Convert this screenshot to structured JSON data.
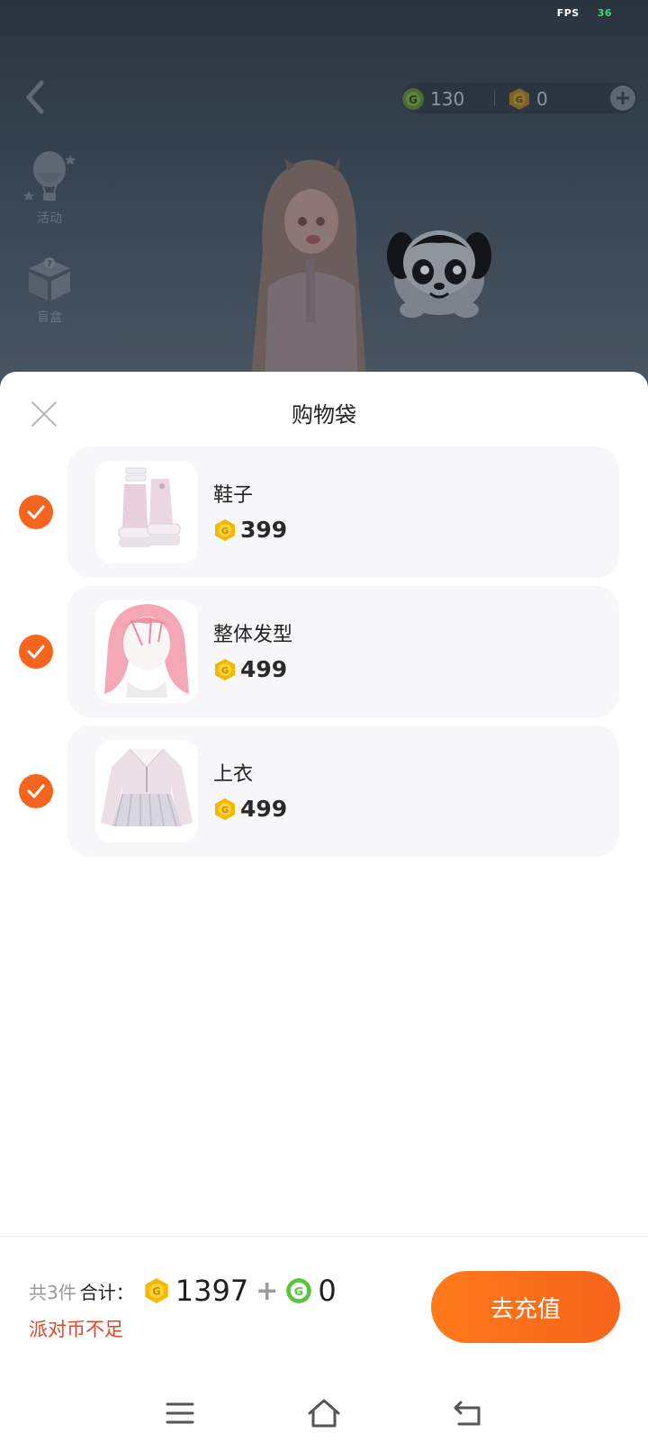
{
  "status": {
    "fps_label": "FPS",
    "fps_value": "36"
  },
  "header": {
    "currency_green": "130",
    "currency_gold": "0"
  },
  "side_menu": {
    "activity_label": "活动",
    "blindbox_label": "盲盒"
  },
  "sheet": {
    "title": "购物袋",
    "items": [
      {
        "name": "鞋子",
        "price": "399",
        "checked": true,
        "icon": "shoes-icon"
      },
      {
        "name": "整体发型",
        "price": "499",
        "checked": true,
        "icon": "hairstyle-icon"
      },
      {
        "name": "上衣",
        "price": "499",
        "checked": true,
        "icon": "top-icon"
      }
    ]
  },
  "footer": {
    "count_label": "共3件",
    "total_label": "合计：",
    "gold_total": "1397",
    "plus": "+",
    "green_total": "0",
    "warning": "派对币不足",
    "recharge_label": "去充值"
  },
  "colors": {
    "accent": "#f5651d",
    "warning": "#e2452a",
    "gold_coin": "#f5b800",
    "green_coin": "#58c53a"
  }
}
